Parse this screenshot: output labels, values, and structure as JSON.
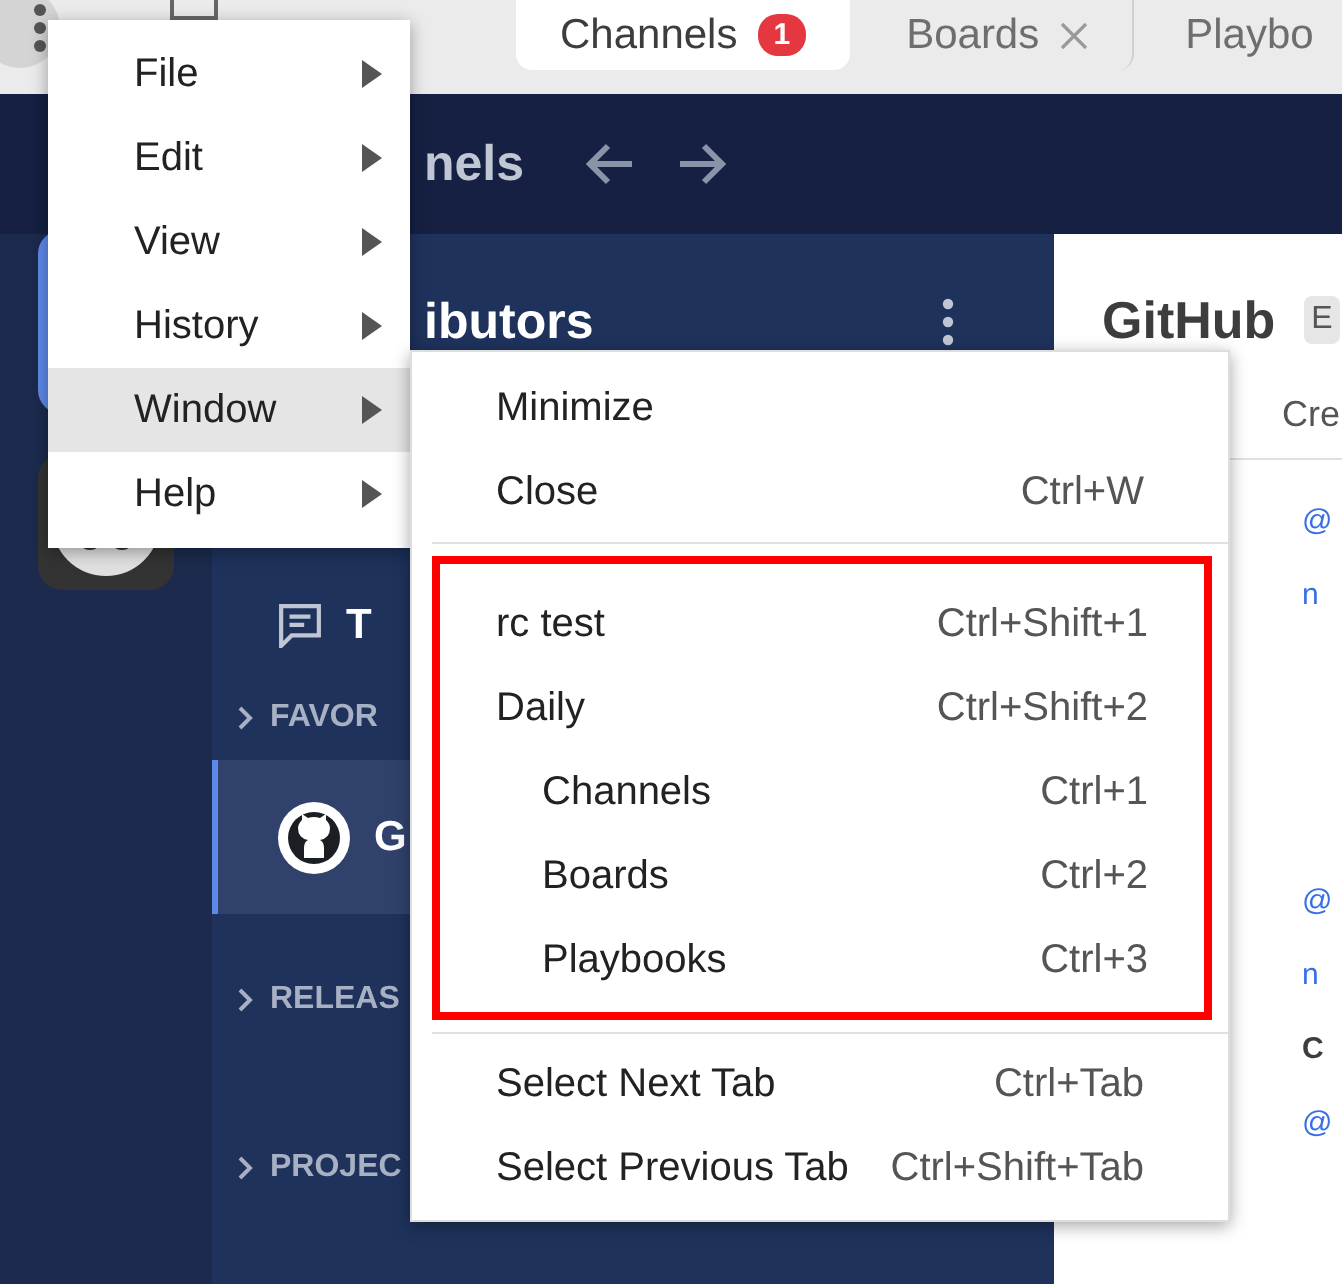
{
  "tab_bar": {
    "tabs": [
      {
        "label": "Channels",
        "selected": true,
        "closable": false,
        "badge": "1"
      },
      {
        "label": "Boards",
        "selected": false,
        "closable": true
      },
      {
        "label": "Playbo",
        "selected": false,
        "closable": false
      }
    ]
  },
  "header": {
    "title": "nels"
  },
  "team_sidebar": {
    "teams": [
      {
        "selected": true
      },
      {
        "selected": false
      }
    ]
  },
  "channel_sidebar": {
    "title": "ibutors",
    "items": [
      {
        "kind": "threads",
        "label": "T",
        "selected": false
      },
      {
        "kind": "category",
        "label": "FAVOR",
        "selected": false
      },
      {
        "kind": "channel",
        "label": "G",
        "selected": true
      },
      {
        "kind": "category",
        "label": "RELEAS",
        "selected": false
      },
      {
        "kind": "category",
        "label": "PROJEC",
        "selected": false
      }
    ]
  },
  "channel_view": {
    "title": "GitHub",
    "badge": "E",
    "tab": "Cre",
    "lines": [
      {
        "kind": "link",
        "text": "@"
      },
      {
        "kind": "link",
        "text": "n"
      },
      {
        "kind": "gap"
      },
      {
        "kind": "link",
        "text": "@"
      },
      {
        "kind": "link",
        "text": "n"
      },
      {
        "kind": "author",
        "text": "C"
      },
      {
        "kind": "link",
        "text": "@"
      }
    ]
  },
  "menu": {
    "items": [
      {
        "label": "File",
        "selected": false
      },
      {
        "label": "Edit",
        "selected": false
      },
      {
        "label": "View",
        "selected": false
      },
      {
        "label": "History",
        "selected": false
      },
      {
        "label": "Window",
        "selected": true
      },
      {
        "label": "Help",
        "selected": false
      }
    ]
  },
  "submenu": {
    "groups": [
      {
        "highlighted": false,
        "items": [
          {
            "label": "Minimize"
          },
          {
            "label": "Close",
            "shortcut": "Ctrl+W"
          }
        ]
      },
      {
        "highlighted": true,
        "items": [
          {
            "label": "rc test",
            "shortcut": "Ctrl+Shift+1"
          },
          {
            "label": "Daily",
            "shortcut": "Ctrl+Shift+2",
            "children": [
              {
                "label": "Channels",
                "shortcut": "Ctrl+1"
              },
              {
                "label": "Boards",
                "shortcut": "Ctrl+2"
              },
              {
                "label": "Playbooks",
                "shortcut": "Ctrl+3"
              }
            ]
          }
        ]
      },
      {
        "highlighted": false,
        "items": [
          {
            "label": "Select Next Tab",
            "shortcut": "Ctrl+Tab"
          },
          {
            "label": "Select Previous Tab",
            "shortcut": "Ctrl+Shift+Tab"
          }
        ]
      }
    ]
  }
}
